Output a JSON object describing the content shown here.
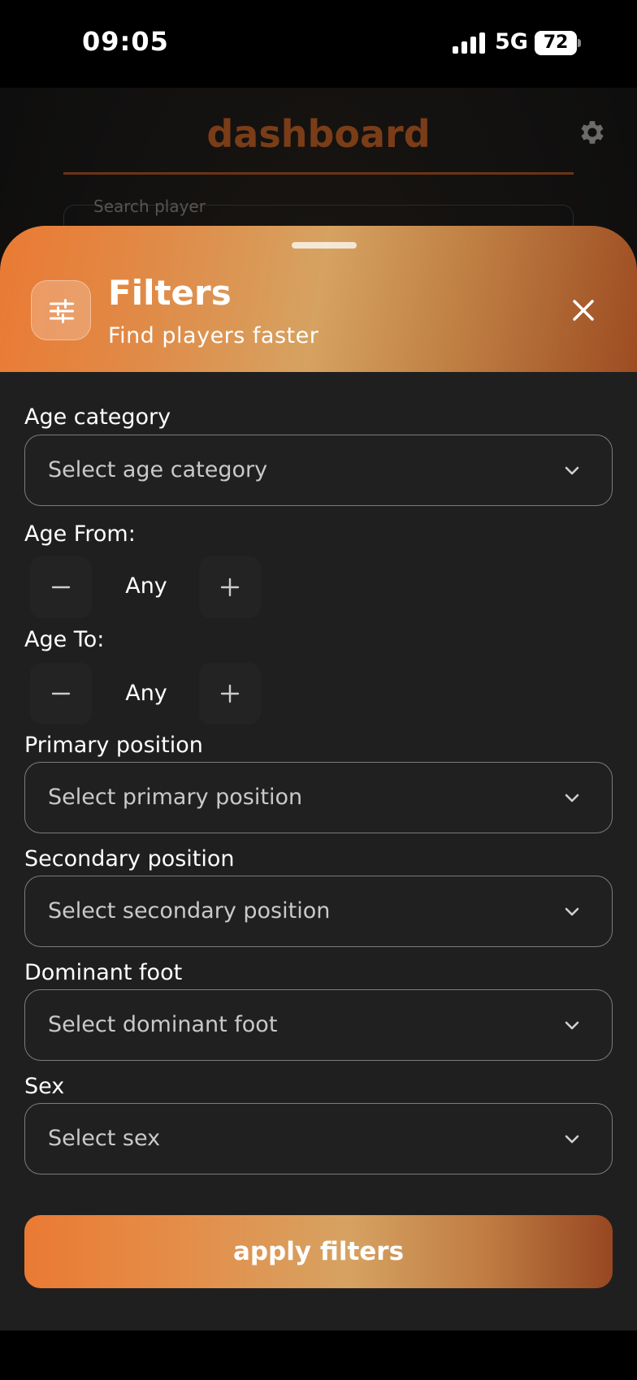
{
  "status_bar": {
    "time": "09:05",
    "network": "5G",
    "battery": "72"
  },
  "background": {
    "title": "dashboard",
    "search_placeholder": "Search player"
  },
  "sheet": {
    "title": "Filters",
    "subtitle": "Find players faster",
    "age_category": {
      "label": "Age category",
      "placeholder": "Select age category"
    },
    "age_from": {
      "label": "Age From:",
      "value": "Any"
    },
    "age_to": {
      "label": "Age To:",
      "value": "Any"
    },
    "primary_position": {
      "label": "Primary position",
      "placeholder": "Select primary position"
    },
    "secondary_position": {
      "label": "Secondary position",
      "placeholder": "Select secondary position"
    },
    "dominant_foot": {
      "label": "Dominant foot",
      "placeholder": "Select dominant foot"
    },
    "sex": {
      "label": "Sex",
      "placeholder": "Select sex"
    },
    "apply_label": "apply filters"
  },
  "colors": {
    "accent": "#ea7a33",
    "sheet_bg": "#1f1f1f",
    "border": "#7c7c7c"
  },
  "icons": [
    "signal-icon",
    "battery-icon",
    "gear-icon",
    "filter-sliders-icon",
    "close-icon",
    "chevron-down-icon",
    "minus-icon",
    "plus-icon"
  ]
}
